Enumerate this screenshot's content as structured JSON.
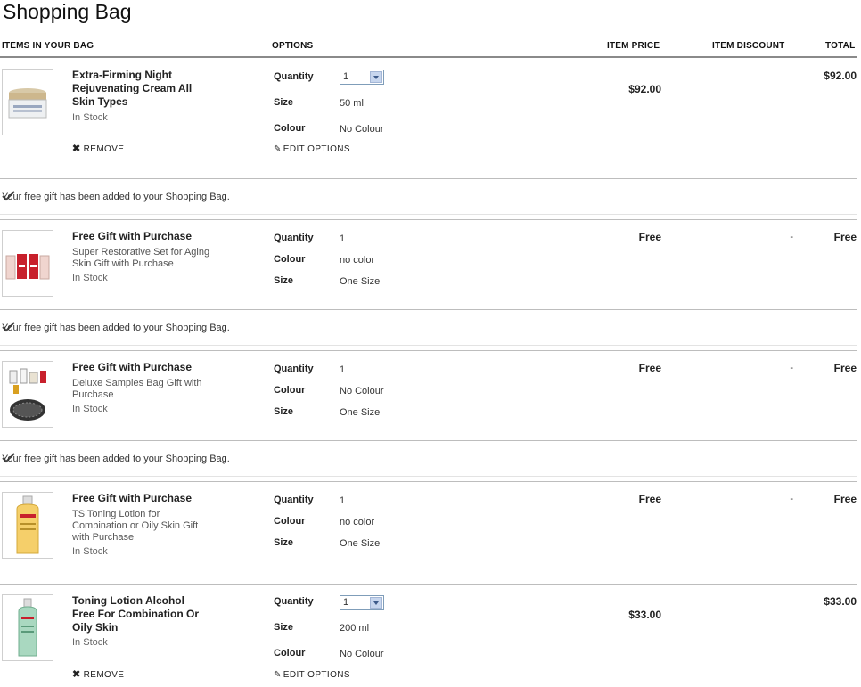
{
  "page": {
    "title": "Shopping Bag"
  },
  "headers": {
    "items": "ITEMS IN YOUR BAG",
    "options": "OPTIONS",
    "item_price": "ITEM PRICE",
    "item_discount": "ITEM DISCOUNT",
    "total": "TOTAL"
  },
  "gift_message": "Your free gift has been added to your Shopping Bag.",
  "labels": {
    "quantity": "Quantity",
    "size": "Size",
    "colour": "Colour",
    "remove": "REMOVE",
    "edit_options": "EDIT OPTIONS",
    "remove_glyph": "✖",
    "edit_glyph": "✎"
  },
  "items": [
    {
      "name": "Extra-Firming Night Rejuvenating Cream All Skin Types",
      "stock": "In Stock",
      "quantity": "1",
      "size": "50 ml",
      "colour": "No Colour",
      "price": "$92.00",
      "total": "$92.00",
      "image_icon": "cream-jar-icon"
    },
    {
      "name": "Free Gift with Purchase",
      "description": "Super Restorative Set for Aging Skin Gift with Purchase",
      "stock": "In Stock",
      "quantity": "1",
      "colour": "no color",
      "size": "One Size",
      "price": "Free",
      "discount": "-",
      "total": "Free",
      "image_icon": "gift-set-icon"
    },
    {
      "name": "Free Gift with Purchase",
      "description": "Deluxe Samples Bag Gift with Purchase",
      "stock": "In Stock",
      "quantity": "1",
      "colour": "No Colour",
      "size": "One Size",
      "price": "Free",
      "discount": "-",
      "total": "Free",
      "image_icon": "samples-bag-icon"
    },
    {
      "name": "Free Gift with Purchase",
      "description": "TS Toning Lotion for Combination or Oily Skin Gift with Purchase",
      "stock": "In Stock",
      "quantity": "1",
      "colour": "no color",
      "size": "One Size",
      "price": "Free",
      "discount": "-",
      "total": "Free",
      "image_icon": "toning-lotion-bottle-icon"
    },
    {
      "name": "Toning Lotion Alcohol Free For Combination Or Oily Skin",
      "stock": "In Stock",
      "quantity": "1",
      "size": "200 ml",
      "colour": "No Colour",
      "price": "$33.00",
      "total": "$33.00",
      "image_icon": "green-lotion-bottle-icon"
    }
  ]
}
